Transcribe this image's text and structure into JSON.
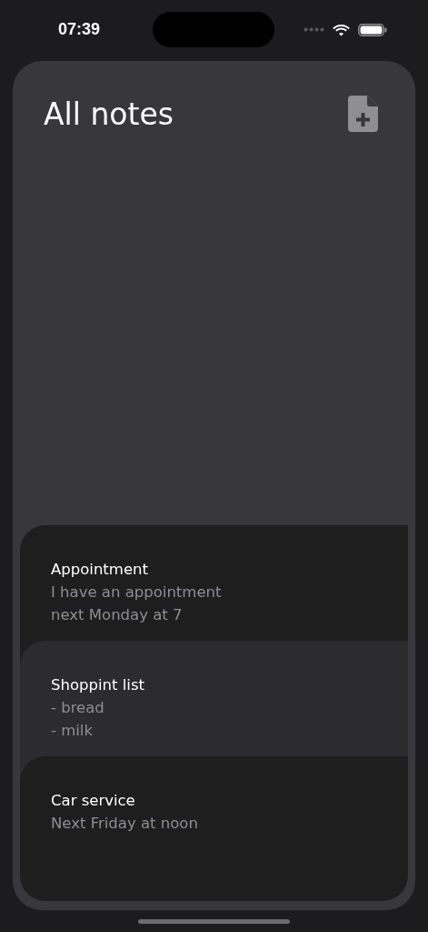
{
  "status_bar": {
    "time": "07:39"
  },
  "header": {
    "title": "All notes"
  },
  "notes": [
    {
      "title": "Appointment",
      "body": [
        "I have an appointment",
        "next Monday at 7"
      ]
    },
    {
      "title": "Shoppint list",
      "body": [
        "- bread",
        "- milk"
      ]
    },
    {
      "title": "Car service",
      "body": [
        "Next Friday at noon"
      ]
    }
  ]
}
